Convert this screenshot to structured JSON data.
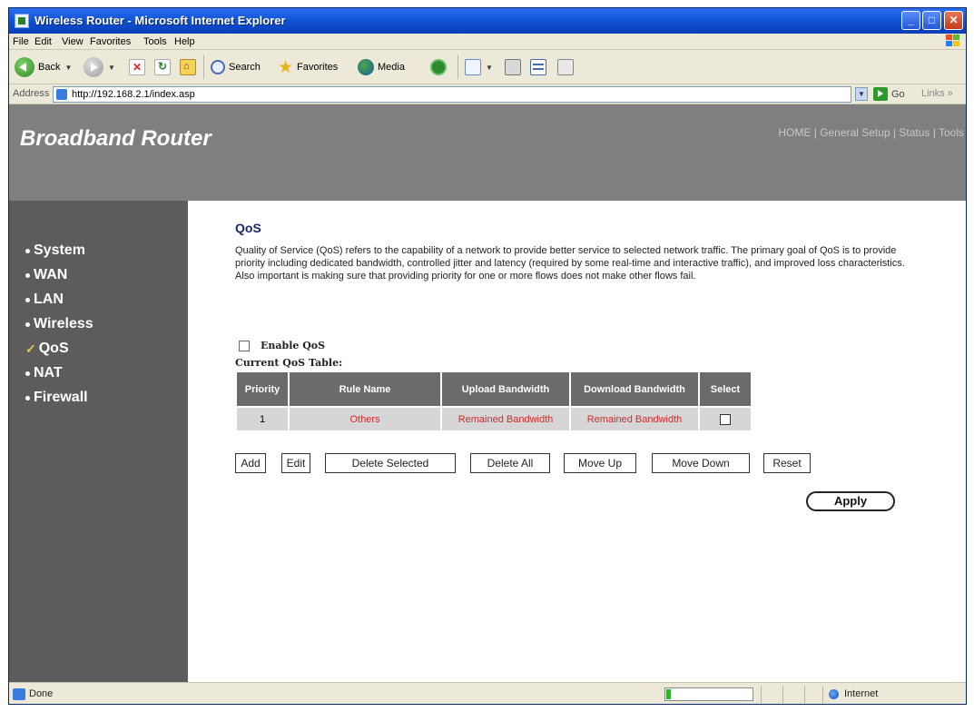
{
  "window": {
    "title": "Wireless Router - Microsoft Internet Explorer",
    "controls": [
      "_",
      "□",
      "✕"
    ]
  },
  "menu": [
    "File",
    "Edit",
    "View",
    "Favorites",
    "Tools",
    "Help"
  ],
  "toolbar": {
    "back": "Back",
    "search": "Search",
    "favorites": "Favorites",
    "media": "Media"
  },
  "address": {
    "label": "Address",
    "url": "http://192.168.2.1/index.asp",
    "go": "Go",
    "links": "Links"
  },
  "header": {
    "brand": "Broadband Router",
    "nav": [
      "HOME",
      "General Setup",
      "Status",
      "Tools"
    ],
    "nav_sep": "|"
  },
  "sidebar": {
    "items": [
      {
        "label": "System",
        "selected": false
      },
      {
        "label": "WAN",
        "selected": false
      },
      {
        "label": "LAN",
        "selected": false
      },
      {
        "label": "Wireless",
        "selected": false
      },
      {
        "label": "QoS",
        "selected": true
      },
      {
        "label": "NAT",
        "selected": false
      },
      {
        "label": "Firewall",
        "selected": false
      }
    ]
  },
  "main": {
    "title": "QoS",
    "description": "Quality of Service (QoS) refers to the capability of a network to provide better service to selected network traffic. The primary goal of QoS is to provide priority including dedicated bandwidth, controlled jitter and latency (required by some real-time and interactive traffic), and improved loss characteristics. Also important is making sure that providing priority for one or more flows does not make other flows fail.",
    "enable_label": "Enable QoS",
    "enable_checked": false,
    "table_caption": "Current QoS Table:",
    "table": {
      "headers": [
        "Priority",
        "Rule Name",
        "Upload Bandwidth",
        "Download Bandwidth",
        "Select"
      ],
      "rows": [
        {
          "priority": "1",
          "rule": "Others",
          "upload": "Remained Bandwidth",
          "download": "Remained Bandwidth",
          "selected": false
        }
      ]
    },
    "buttons": {
      "add": "Add",
      "edit": "Edit",
      "delete_selected": "Delete Selected",
      "delete_all": "Delete All",
      "move_up": "Move Up",
      "move_down": "Move Down",
      "reset": "Reset"
    },
    "apply": "Apply"
  },
  "status": {
    "text": "Done",
    "zone": "Internet",
    "progress": 0.05
  },
  "colors": {
    "title_bar": "#0d4fd1",
    "header_bg": "#7f7f7f",
    "sidebar_bg": "#5c5c5c",
    "table_header_bg": "#6b6b6b",
    "table_cell_bg": "#d6d6d6",
    "red_text": "#d42a2a",
    "check_mark": "#e6c84a"
  }
}
